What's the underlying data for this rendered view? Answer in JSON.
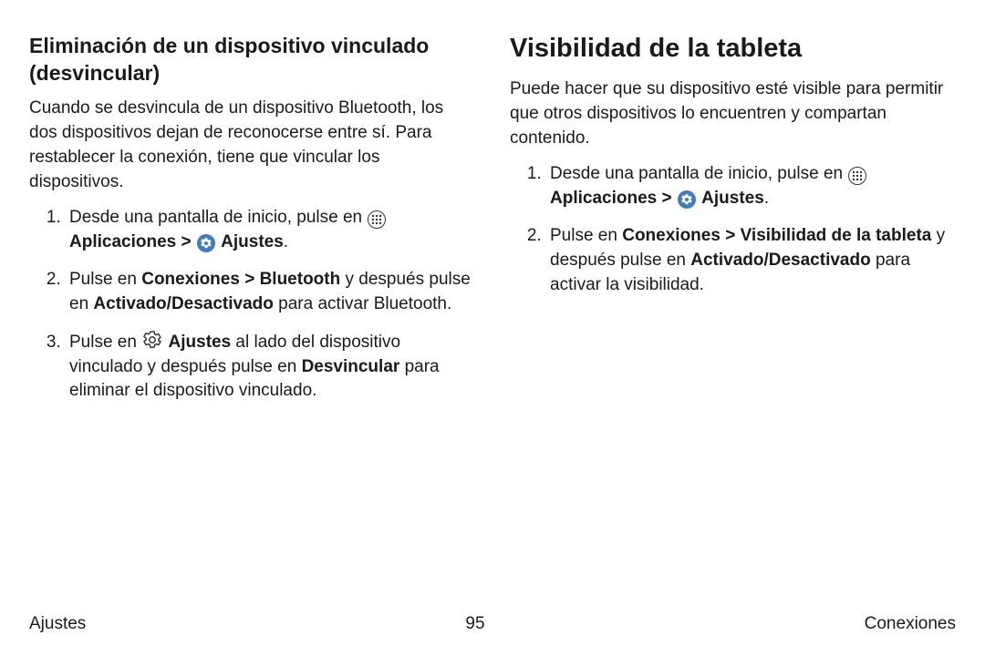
{
  "left": {
    "heading": "Eliminación de un dispositivo vinculado (desvincular)",
    "intro": "Cuando se desvincula de un dispositivo Bluetooth, los dos dispositivos dejan de reconocerse entre sí. Para restablecer la conexión, tiene que vincular los dispositivos.",
    "step1_pre": "Desde una pantalla de inicio, pulse en ",
    "step1_apps": "Aplicaciones",
    "step1_sep": " > ",
    "step1_ajustes": "Ajustes",
    "step1_end": ".",
    "step2_a": "Pulse en ",
    "step2_b": "Conexiones > Bluetooth",
    "step2_c": " y después pulse en ",
    "step2_d": "Activado/Desactivado",
    "step2_e": " para activar Bluetooth.",
    "step3_a": "Pulse en ",
    "step3_b": "Ajustes",
    "step3_c": " al lado del dispositivo vinculado y después pulse en ",
    "step3_d": "Desvincular",
    "step3_e": " para eliminar el dispositivo vinculado."
  },
  "right": {
    "heading": "Visibilidad de la tableta",
    "intro": "Puede hacer que su dispositivo esté visible para permitir que otros dispositivos lo encuentren y compartan contenido.",
    "step1_pre": "Desde una pantalla de inicio, pulse en ",
    "step1_apps": "Aplicaciones",
    "step1_sep": " > ",
    "step1_ajustes": "Ajustes",
    "step1_end": ".",
    "step2_a": "Pulse en ",
    "step2_b": "Conexiones > Visibilidad de la tableta",
    "step2_c": " y después pulse en ",
    "step2_d": "Activado/Desactivado",
    "step2_e": " para activar la visibilidad."
  },
  "footer": {
    "left": "Ajustes",
    "center": "95",
    "right": "Conexiones"
  }
}
